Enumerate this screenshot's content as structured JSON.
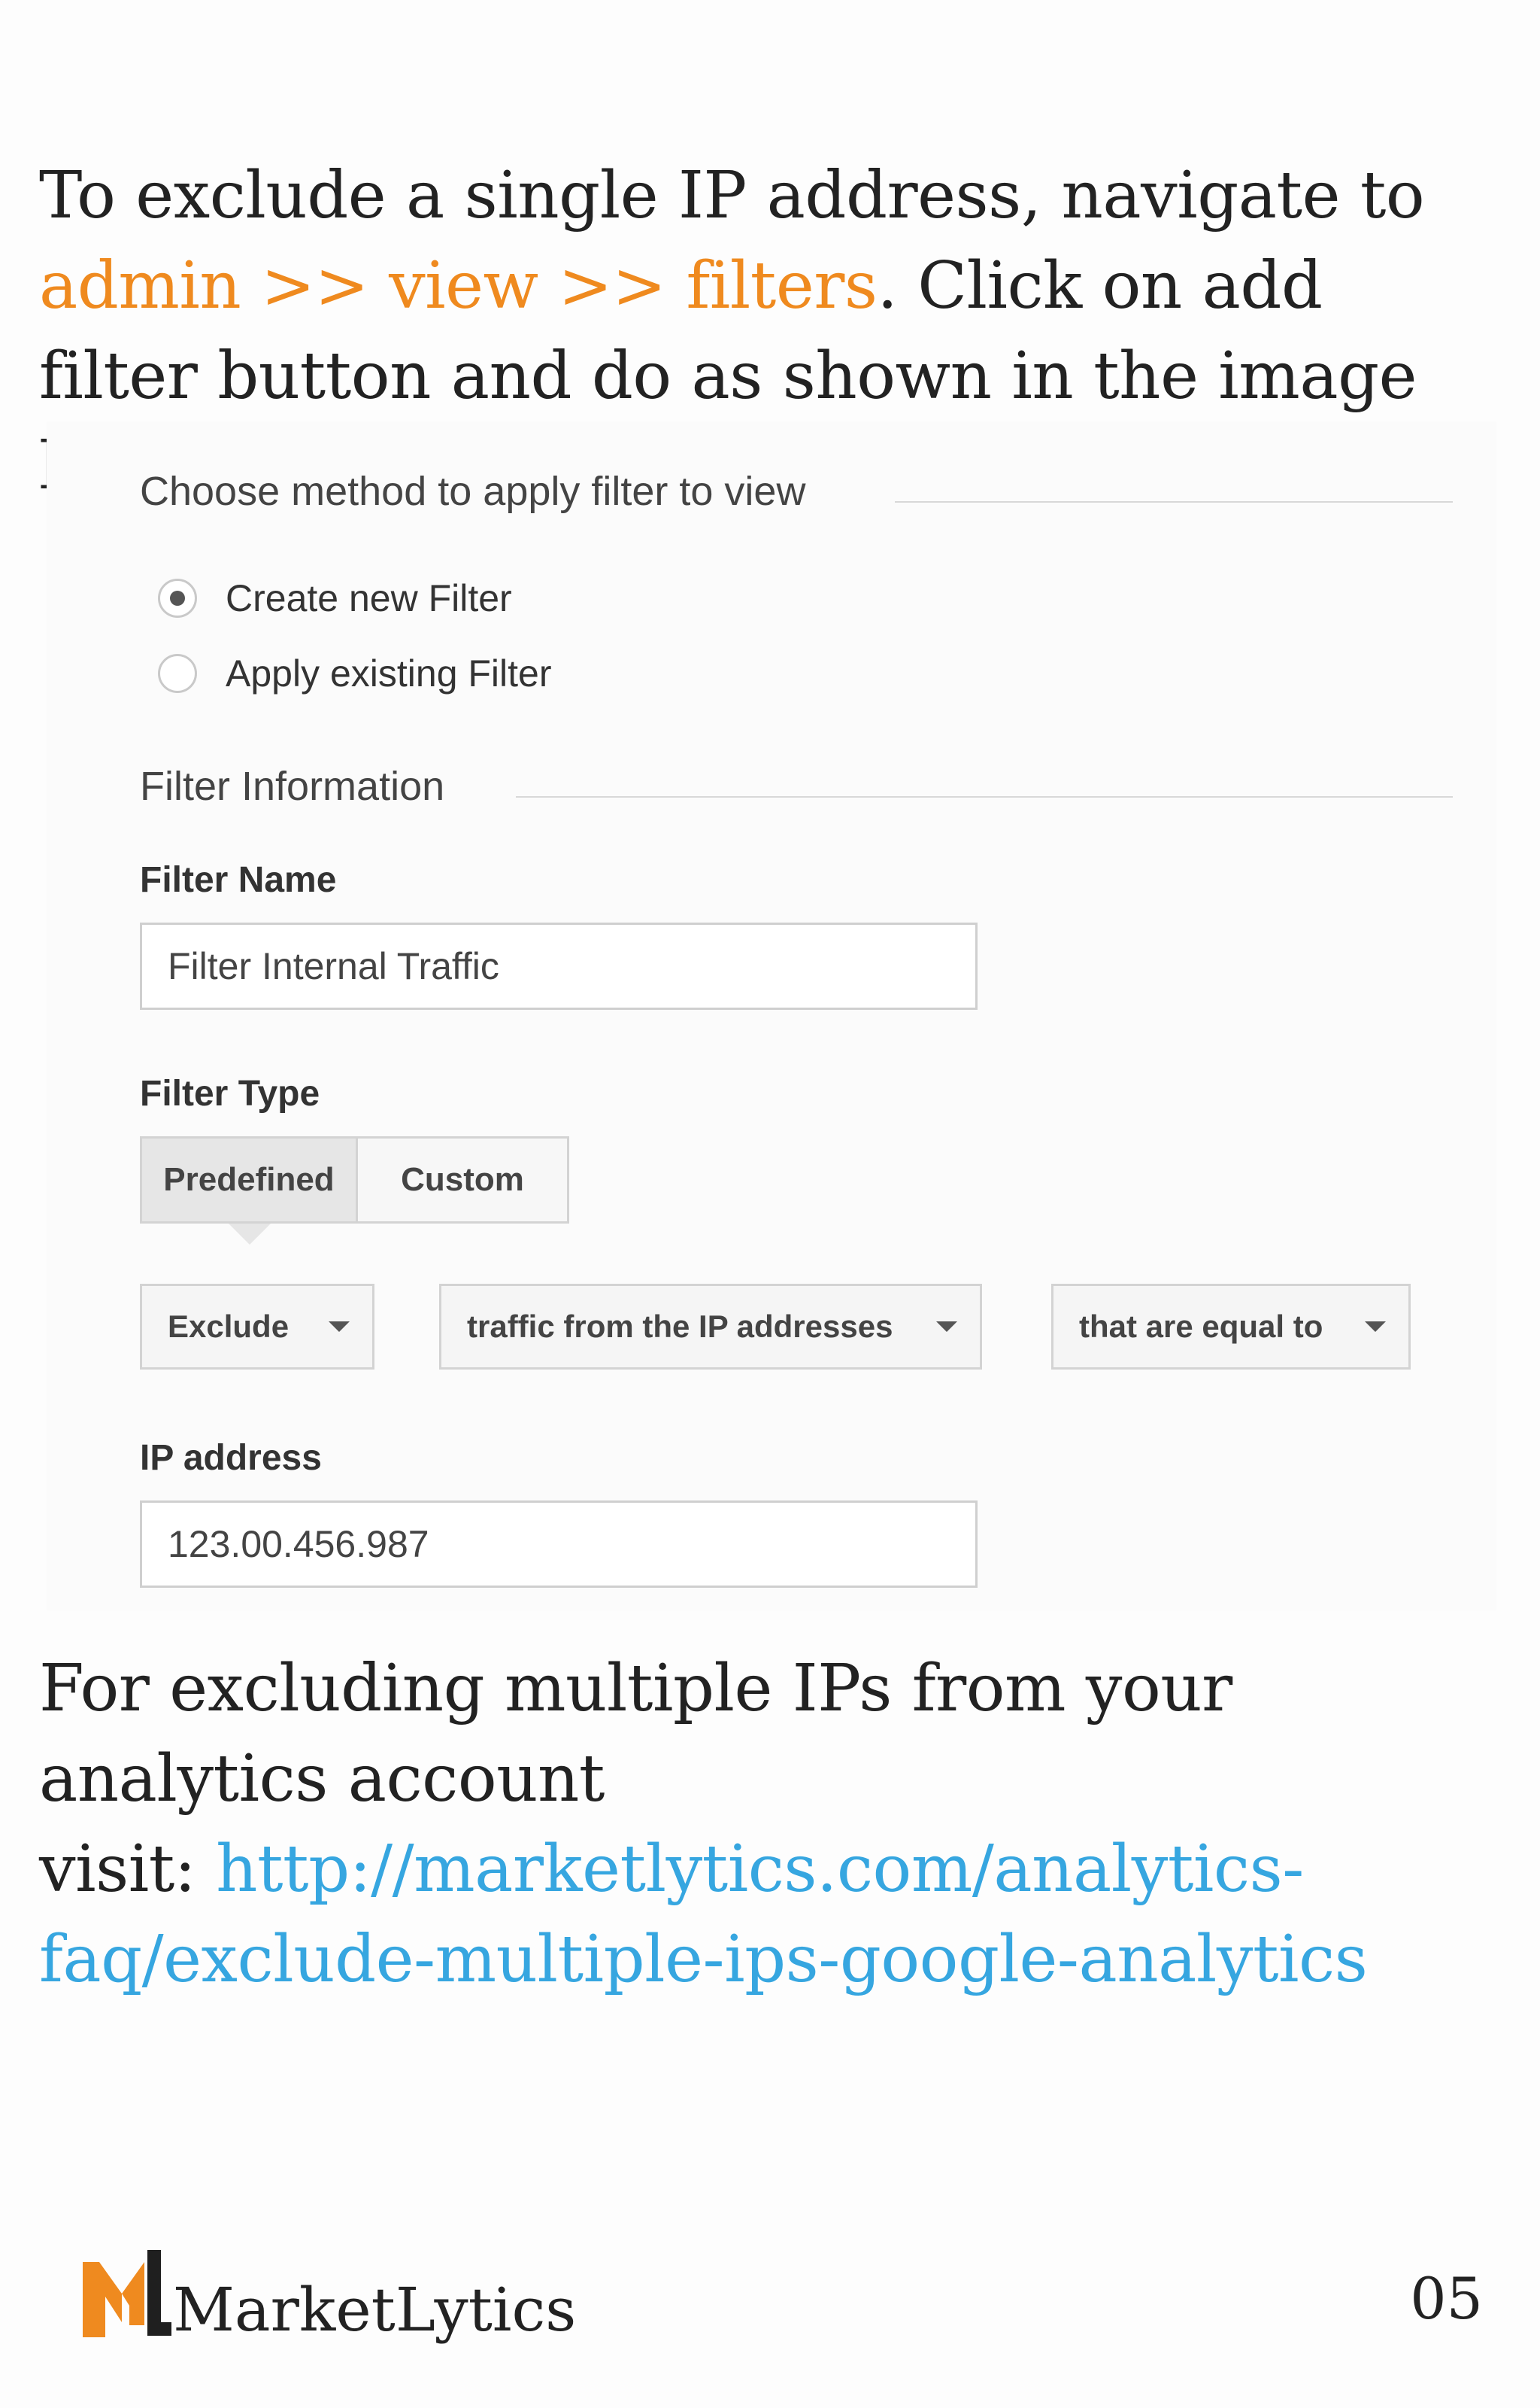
{
  "intro": {
    "text_before": "To exclude a single IP address, navigate to ",
    "path_admin": "admin",
    "path_sep1": " >> ",
    "path_view": "view",
    "path_sep2": " >> ",
    "path_filters": "filters",
    "text_after": ". Click on add filter button and do as shown in the image below."
  },
  "form": {
    "method_title": "Choose method to apply filter to view",
    "radio_create": "Create new Filter",
    "radio_apply": "Apply existing Filter",
    "info_title": "Filter Information",
    "filter_name_label": "Filter Name",
    "filter_name_value": "Filter Internal Traffic",
    "filter_type_label": "Filter Type",
    "tab_predefined": "Predefined",
    "tab_custom": "Custom",
    "dropdown_1": "Exclude",
    "dropdown_2": "traffic from the IP addresses",
    "dropdown_3": "that are equal to",
    "ip_label": "IP address",
    "ip_value": "123.00.456.987"
  },
  "outro": {
    "line1": "For excluding multiple IPs from your analytics account",
    "visit": "visit: ",
    "link_part1": "http://marketlytics.com/analytics-",
    "link_part2": "faq/exclude-multiple-ips-google-analytics"
  },
  "footer": {
    "brand": "MarketLytics",
    "page_number": "05",
    "logo_icon": "marketlytics-ml-logo-icon",
    "colors": {
      "orange": "#ef8a1f",
      "link_blue": "#36a6e0"
    }
  }
}
